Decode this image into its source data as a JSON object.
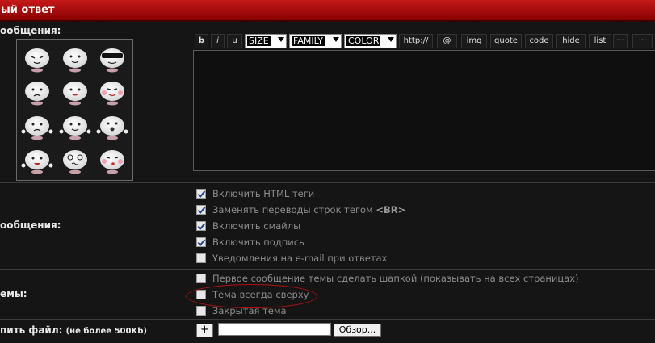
{
  "header": {
    "title": "ый ответ"
  },
  "labels": {
    "message": "ообщения:",
    "options": "ообщения:",
    "topic": "емы:",
    "attach": "пить файл:",
    "attach_note": "(не более 500Kb)"
  },
  "toolbar": {
    "bold": "b",
    "italic": "i",
    "underline": "u",
    "size": "SIZE",
    "family": "FAMILY",
    "color": "COLOR",
    "http": "http://",
    "at": "@",
    "img": "img",
    "quote": "quote",
    "code": "code",
    "hide": "hide",
    "list": "list",
    "more": "···"
  },
  "options": [
    {
      "label": "Включить HTML теги",
      "checked": true
    },
    {
      "label": "Заменять переводы строк тегом ",
      "tag": "<BR>",
      "checked": true
    },
    {
      "label": "Включить смайлы",
      "checked": true
    },
    {
      "label": "Включить подпись",
      "checked": true
    },
    {
      "label": "Уведомления на e-mail при ответах",
      "checked": false
    }
  ],
  "topic_options": [
    {
      "label": "Первое сообщение темы сделать шапкой (показывать на всех страницах)",
      "checked": false
    },
    {
      "label": "Тёма всегда сверху",
      "checked": false
    },
    {
      "label": "Закрытая тема",
      "checked": false
    }
  ],
  "attach": {
    "add_label": "+",
    "browse_label": "Обзор..."
  },
  "smileys": [
    "wink-smiley",
    "smile-smiley",
    "cool-smiley",
    "sad-smiley",
    "happy-smiley",
    "blush-smiley",
    "frown-smiley",
    "laugh-smiley",
    "surprised-smiley",
    "tongue-smiley",
    "dizzy-smiley",
    "kiss-smiley"
  ]
}
